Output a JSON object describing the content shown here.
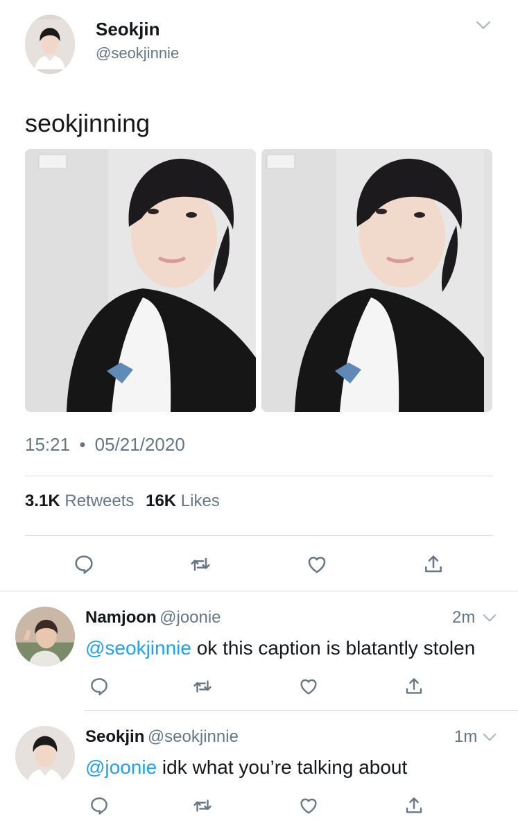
{
  "main_tweet": {
    "author_name": "Seokjin",
    "author_handle": "@seokjinnie",
    "text": "seokjinning",
    "time": "15:21",
    "separator": "•",
    "date": "05/21/2020",
    "retweets_count": "3.1K",
    "retweets_label": "Retweets",
    "likes_count": "16K",
    "likes_label": "Likes",
    "icons": [
      "reply-icon",
      "retweet-icon",
      "like-icon",
      "share-icon",
      "chevron-down-icon"
    ]
  },
  "replies": [
    {
      "author_name": "Namjoon",
      "author_handle": "@joonie",
      "time": "2m",
      "mention": "@seokjinnie",
      "text": " ok this caption is blatantly stolen"
    },
    {
      "author_name": "Seokjin",
      "author_handle": "@seokjinnie",
      "time": "1m",
      "mention": "@joonie",
      "text": " idk what you’re talking about"
    }
  ],
  "colors": {
    "text": "#14171a",
    "secondary": "#657786",
    "link": "#1da1f2",
    "divider": "#d8dde1"
  }
}
